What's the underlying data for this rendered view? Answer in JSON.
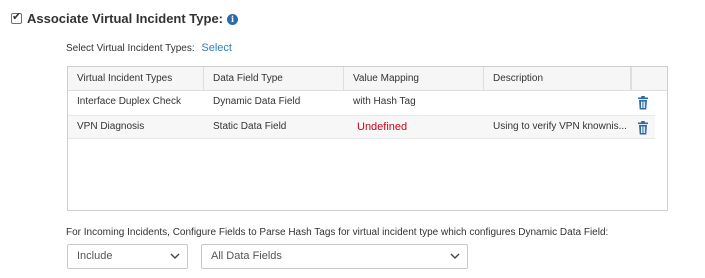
{
  "header": {
    "title": "Associate Virtual Incident Type:",
    "checked": true,
    "info_icon": "info-icon"
  },
  "select_row": {
    "label": "Select Virtual Incident Types:",
    "link": "Select"
  },
  "table": {
    "columns": [
      "Virtual Incident Types",
      "Data Field Type",
      "Value Mapping",
      "Description"
    ],
    "rows": [
      {
        "type": "Interface Duplex Check",
        "field_type": "Dynamic Data Field",
        "value_mapping": "with Hash Tag",
        "description": ""
      },
      {
        "type": "VPN Diagnosis",
        "field_type": "Static Data Field",
        "value_mapping": "Undefined",
        "description": "Using to verify VPN knownis..."
      }
    ],
    "row_action_icon": "trash-icon"
  },
  "incoming": {
    "text": "For Incoming Incidents, Configure Fields to Parse Hash Tags for virtual incident type which configures Dynamic Data Field:"
  },
  "dropdowns": {
    "include_value": "Include",
    "fields_value": "All Data Fields"
  },
  "colors": {
    "link": "#2f7fc1",
    "undefined": "#d0021b",
    "trash": "#2f6aa6",
    "info": "#2f6aa6"
  }
}
